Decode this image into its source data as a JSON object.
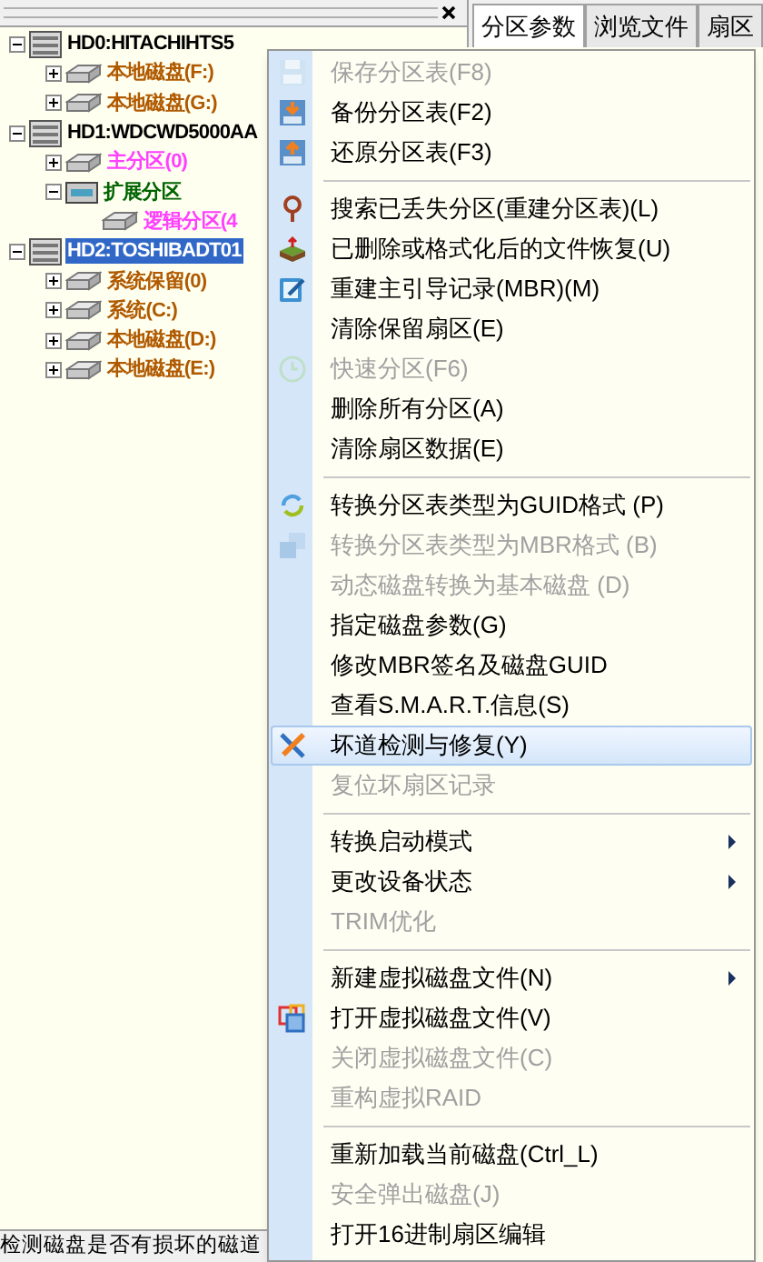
{
  "tabs": [
    {
      "label": "分区参数",
      "selected": true
    },
    {
      "label": "浏览文件",
      "selected": false
    },
    {
      "label": "扇区",
      "selected": false
    }
  ],
  "tree": [
    {
      "label": "HD0:HITACHIHTS5",
      "kind": "disk",
      "color": "#000000",
      "selected": false,
      "expanded": true,
      "children": [
        {
          "label": "本地磁盘(F:)",
          "kind": "partition",
          "color": "#b05a00",
          "selected": false,
          "expanded": false
        },
        {
          "label": "本地磁盘(G:)",
          "kind": "partition",
          "color": "#b05a00",
          "selected": false,
          "expanded": false
        }
      ]
    },
    {
      "label": "HD1:WDCWD5000AA",
      "kind": "disk",
      "color": "#000000",
      "selected": false,
      "expanded": true,
      "children": [
        {
          "label": "主分区(0)",
          "kind": "partition",
          "color": "#ff40ff",
          "selected": false,
          "expanded": false
        },
        {
          "label": "扩展分区",
          "kind": "extended",
          "color": "#006400",
          "selected": false,
          "expanded": true,
          "children": [
            {
              "label": "逻辑分区(4",
              "kind": "partition",
              "color": "#ff40ff",
              "selected": false
            }
          ]
        }
      ]
    },
    {
      "label": "HD2:TOSHIBADT01",
      "kind": "disk",
      "selected": true,
      "expanded": true,
      "children": [
        {
          "label": "系统保留(0)",
          "kind": "partition",
          "color": "#b05a00",
          "selected": false,
          "expanded": false
        },
        {
          "label": "系统(C:)",
          "kind": "partition",
          "color": "#b05a00",
          "selected": false,
          "expanded": false
        },
        {
          "label": "本地磁盘(D:)",
          "kind": "partition",
          "color": "#b05a00",
          "selected": false,
          "expanded": false
        },
        {
          "label": "本地磁盘(E:)",
          "kind": "partition",
          "color": "#b05a00",
          "selected": false,
          "expanded": false
        }
      ]
    }
  ],
  "status_bar": "检测磁盘是否有损坏的磁道",
  "menu": [
    {
      "kind": "item",
      "label": "保存分区表(F8)",
      "disabled": true,
      "submenu": false,
      "selected": false
    },
    {
      "kind": "item",
      "label": "备份分区表(F2)",
      "disabled": false,
      "submenu": false,
      "selected": false
    },
    {
      "kind": "item",
      "label": "还原分区表(F3)",
      "disabled": false,
      "submenu": false,
      "selected": false
    },
    {
      "kind": "separator"
    },
    {
      "kind": "item",
      "label": "搜索已丢失分区(重建分区表)(L)",
      "disabled": false,
      "submenu": false,
      "selected": false
    },
    {
      "kind": "item",
      "label": "已删除或格式化后的文件恢复(U)",
      "disabled": false,
      "submenu": false,
      "selected": false
    },
    {
      "kind": "item",
      "label": "重建主引导记录(MBR)(M)",
      "disabled": false,
      "submenu": false,
      "selected": false
    },
    {
      "kind": "item",
      "label": "清除保留扇区(E)",
      "disabled": false,
      "submenu": false,
      "selected": false
    },
    {
      "kind": "item",
      "label": "快速分区(F6)",
      "disabled": true,
      "submenu": false,
      "selected": false
    },
    {
      "kind": "item",
      "label": "删除所有分区(A)",
      "disabled": false,
      "submenu": false,
      "selected": false
    },
    {
      "kind": "item",
      "label": "清除扇区数据(E)",
      "disabled": false,
      "submenu": false,
      "selected": false
    },
    {
      "kind": "separator"
    },
    {
      "kind": "item",
      "label": "转换分区表类型为GUID格式 (P)",
      "disabled": false,
      "submenu": false,
      "selected": false
    },
    {
      "kind": "item",
      "label": "转换分区表类型为MBR格式 (B)",
      "disabled": true,
      "submenu": false,
      "selected": false
    },
    {
      "kind": "item",
      "label": "动态磁盘转换为基本磁盘 (D)",
      "disabled": true,
      "submenu": false,
      "selected": false
    },
    {
      "kind": "item",
      "label": "指定磁盘参数(G)",
      "disabled": false,
      "submenu": false,
      "selected": false
    },
    {
      "kind": "item",
      "label": "修改MBR签名及磁盘GUID",
      "disabled": false,
      "submenu": false,
      "selected": false
    },
    {
      "kind": "item",
      "label": "查看S.M.A.R.T.信息(S)",
      "disabled": false,
      "submenu": false,
      "selected": false
    },
    {
      "kind": "item",
      "label": "坏道检测与修复(Y)",
      "disabled": false,
      "submenu": false,
      "selected": true
    },
    {
      "kind": "item",
      "label": "复位坏扇区记录",
      "disabled": true,
      "submenu": false,
      "selected": false
    },
    {
      "kind": "separator"
    },
    {
      "kind": "item",
      "label": "转换启动模式",
      "disabled": false,
      "submenu": true,
      "selected": false
    },
    {
      "kind": "item",
      "label": "更改设备状态",
      "disabled": false,
      "submenu": true,
      "selected": false
    },
    {
      "kind": "item",
      "label": "TRIM优化",
      "disabled": true,
      "submenu": false,
      "selected": false
    },
    {
      "kind": "separator"
    },
    {
      "kind": "item",
      "label": "新建虚拟磁盘文件(N)",
      "disabled": false,
      "submenu": true,
      "selected": false
    },
    {
      "kind": "item",
      "label": "打开虚拟磁盘文件(V)",
      "disabled": false,
      "submenu": false,
      "selected": false
    },
    {
      "kind": "item",
      "label": "关闭虚拟磁盘文件(C)",
      "disabled": true,
      "submenu": false,
      "selected": false
    },
    {
      "kind": "item",
      "label": "重构虚拟RAID",
      "disabled": true,
      "submenu": false,
      "selected": false
    },
    {
      "kind": "separator"
    },
    {
      "kind": "item",
      "label": "重新加载当前磁盘(Ctrl_L)",
      "disabled": false,
      "submenu": false,
      "selected": false
    },
    {
      "kind": "item",
      "label": "安全弹出磁盘(J)",
      "disabled": true,
      "submenu": false,
      "selected": false
    },
    {
      "kind": "item",
      "label": "打开16进制扇区编辑",
      "disabled": false,
      "submenu": false,
      "selected": false
    }
  ]
}
